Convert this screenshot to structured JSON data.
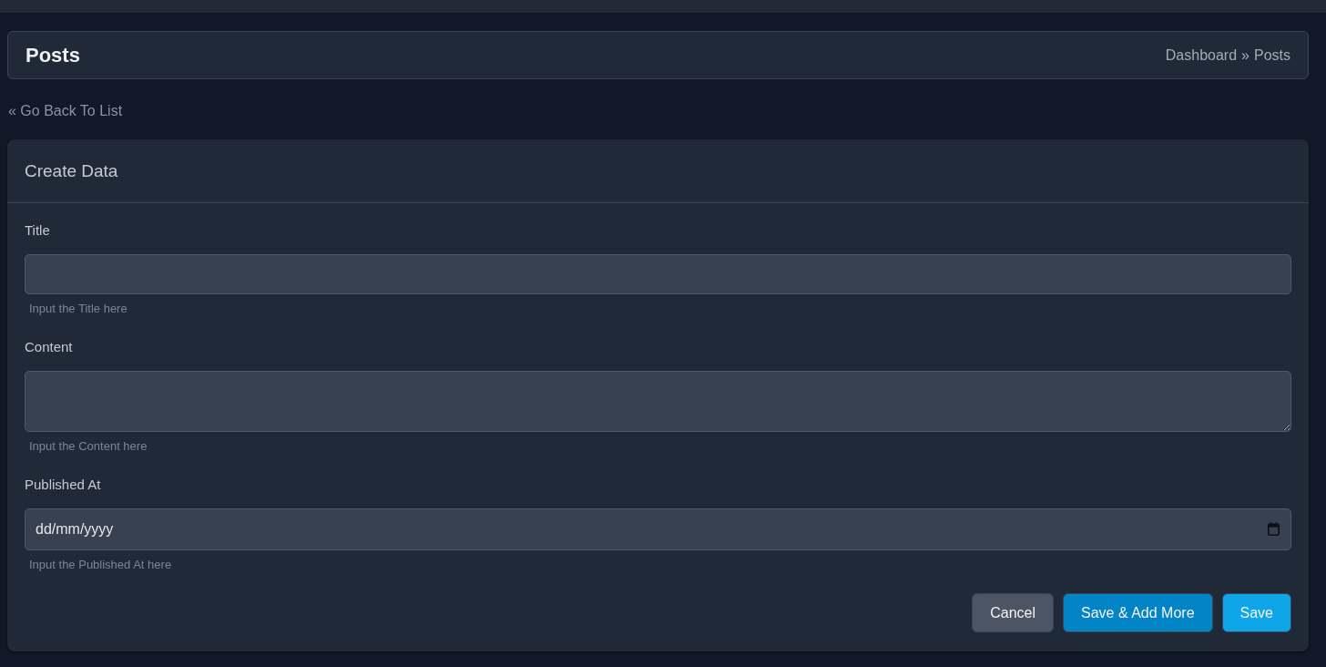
{
  "header": {
    "title": "Posts",
    "breadcrumb": [
      {
        "label": "Dashboard"
      },
      {
        "label": "Posts"
      }
    ],
    "breadcrumb_separator": "»"
  },
  "back_link": {
    "label": "« Go Back To List"
  },
  "form": {
    "title": "Create Data",
    "fields": [
      {
        "label": "Title",
        "kind": "text",
        "help": "Input the Title here"
      },
      {
        "label": "Content",
        "kind": "textarea",
        "help": "Input the Content here"
      },
      {
        "label": "Published At",
        "kind": "date",
        "placeholder": "dd/mm/yyyy",
        "help": "Input the Published At here"
      }
    ],
    "buttons": [
      {
        "label": "Cancel",
        "kind": "secondary"
      },
      {
        "label": "Save & Add More",
        "kind": "primary"
      },
      {
        "label": "Save",
        "kind": "accent"
      }
    ]
  }
}
